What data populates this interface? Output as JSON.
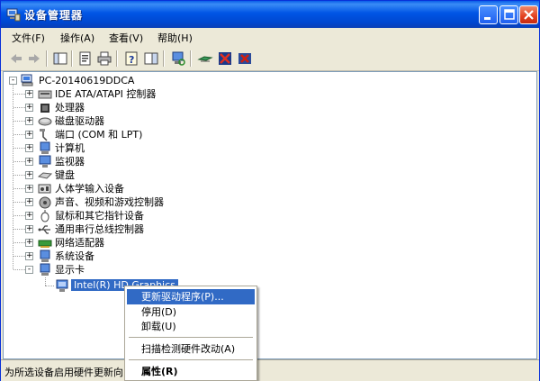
{
  "window": {
    "title": "设备管理器",
    "icon": "device-manager-icon"
  },
  "menubar": {
    "items": [
      {
        "label": "文件(F)"
      },
      {
        "label": "操作(A)"
      },
      {
        "label": "查看(V)"
      },
      {
        "label": "帮助(H)"
      }
    ]
  },
  "toolbar": {
    "buttons": [
      "back-arrow-icon",
      "forward-arrow-icon",
      "show-hide-console-tree-icon",
      "properties-icon",
      "print-icon",
      "help-icon",
      "show-action-pane-icon",
      "scan-hardware-icon",
      "update-driver-icon",
      "disable-device-icon",
      "uninstall-device-icon"
    ]
  },
  "tree": {
    "root": "PC-20140619DDCA",
    "items": [
      {
        "label": "IDE ATA/ATAPI 控制器",
        "icon": "ide-controller-icon"
      },
      {
        "label": "处理器",
        "icon": "processor-icon"
      },
      {
        "label": "磁盘驱动器",
        "icon": "disk-drive-icon"
      },
      {
        "label": "端口 (COM 和 LPT)",
        "icon": "port-icon"
      },
      {
        "label": "计算机",
        "icon": "computer-icon"
      },
      {
        "label": "监视器",
        "icon": "monitor-icon"
      },
      {
        "label": "键盘",
        "icon": "keyboard-icon"
      },
      {
        "label": "人体学输入设备",
        "icon": "hid-icon"
      },
      {
        "label": "声音、视频和游戏控制器",
        "icon": "sound-icon"
      },
      {
        "label": "鼠标和其它指针设备",
        "icon": "mouse-icon"
      },
      {
        "label": "通用串行总线控制器",
        "icon": "usb-icon"
      },
      {
        "label": "网络适配器",
        "icon": "network-adapter-icon"
      },
      {
        "label": "系统设备",
        "icon": "system-device-icon"
      },
      {
        "label": "显示卡",
        "icon": "display-adapter-icon"
      }
    ],
    "child": {
      "label": "Intel(R) HD Graphics",
      "icon": "display-card-icon"
    }
  },
  "context_menu": {
    "items": [
      {
        "label": "更新驱动程序(P)..."
      },
      {
        "label": "停用(D)"
      },
      {
        "label": "卸载(U)"
      },
      {
        "label": "扫描检测硬件改动(A)"
      },
      {
        "label": "属性(R)"
      }
    ]
  },
  "status": {
    "text": "为所选设备启用硬件更新向"
  },
  "colors": {
    "titlebar": "#0054e3",
    "selection": "#316ac5",
    "chrome": "#ece9d8"
  }
}
